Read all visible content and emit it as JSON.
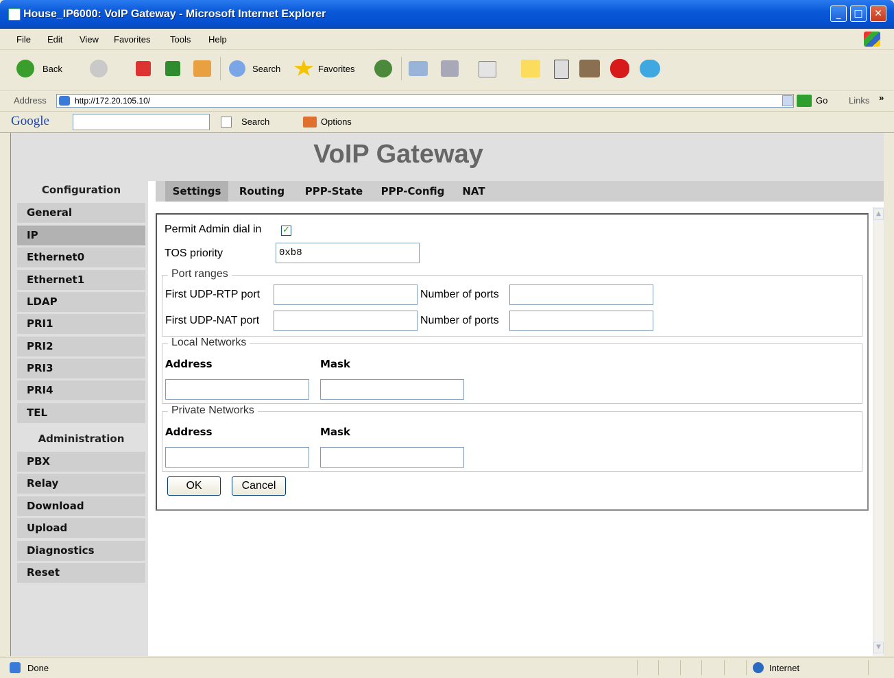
{
  "window": {
    "title": "House_IP6000: VoIP Gateway - Microsoft Internet Explorer",
    "minimize": "_",
    "maximize": "□",
    "close": "✕"
  },
  "menu": [
    "File",
    "Edit",
    "View",
    "Favorites",
    "Tools",
    "Help"
  ],
  "toolbar": {
    "back_label": "Back",
    "search_label": "Search",
    "favorites_label": "Favorites"
  },
  "address": {
    "label": "Address",
    "url": "http://172.20.105.10/",
    "go_label": "Go",
    "links_label": "Links",
    "more": "»"
  },
  "google": {
    "logo": "Google",
    "search_label": "Search",
    "options_label": "Options"
  },
  "page": {
    "title": "VoIP Gateway",
    "sidebar": {
      "config_heading": "Configuration",
      "config_items": [
        "General",
        "IP",
        "Ethernet0",
        "Ethernet1",
        "LDAP",
        "PRI1",
        "PRI2",
        "PRI3",
        "PRI4",
        "TEL"
      ],
      "admin_heading": "Administration",
      "admin_items": [
        "PBX",
        "Relay",
        "Download",
        "Upload",
        "Diagnostics",
        "Reset"
      ]
    },
    "tabs": [
      "Settings",
      "Routing",
      "PPP-State",
      "PPP-Config",
      "NAT"
    ],
    "form": {
      "permit_admin_label": "Permit Admin dial in",
      "permit_admin_checked": true,
      "tos_label": "TOS priority",
      "tos_value": "0xb8",
      "port_ranges_legend": "Port ranges",
      "rtp_label": "First UDP-RTP port",
      "rtp_value": "",
      "rtp_count_label": "Number of ports",
      "rtp_count_value": "",
      "nat_label": "First UDP-NAT port",
      "nat_value": "",
      "nat_count_label": "Number of ports",
      "nat_count_value": "",
      "local_legend": "Local Networks",
      "local_address_label": "Address",
      "local_mask_label": "Mask",
      "local_address_value": "",
      "local_mask_value": "",
      "private_legend": "Private Networks",
      "private_address_label": "Address",
      "private_mask_label": "Mask",
      "private_address_value": "",
      "private_mask_value": "",
      "ok_label": "OK",
      "cancel_label": "Cancel"
    }
  },
  "status": {
    "left": "Done",
    "zone": "Internet"
  },
  "colors": {
    "titlebar": "#0a58d8",
    "chrome": "#ece9d8",
    "nav_bg": "#cfcfcf",
    "nav_selected": "#b2b2b2",
    "header_bg": "#e0e0e0"
  },
  "icons": {
    "back": "back-arrow-icon",
    "forward": "forward-arrow-icon",
    "stop": "stop-icon",
    "refresh": "refresh-icon",
    "home": "home-icon",
    "search": "search-icon",
    "favorites": "favorites-star-icon",
    "history": "history-icon",
    "mail": "mail-icon",
    "print": "print-icon",
    "edit": "edit-word-icon",
    "discuss": "notes-icon",
    "messenger": "messenger-icon"
  }
}
